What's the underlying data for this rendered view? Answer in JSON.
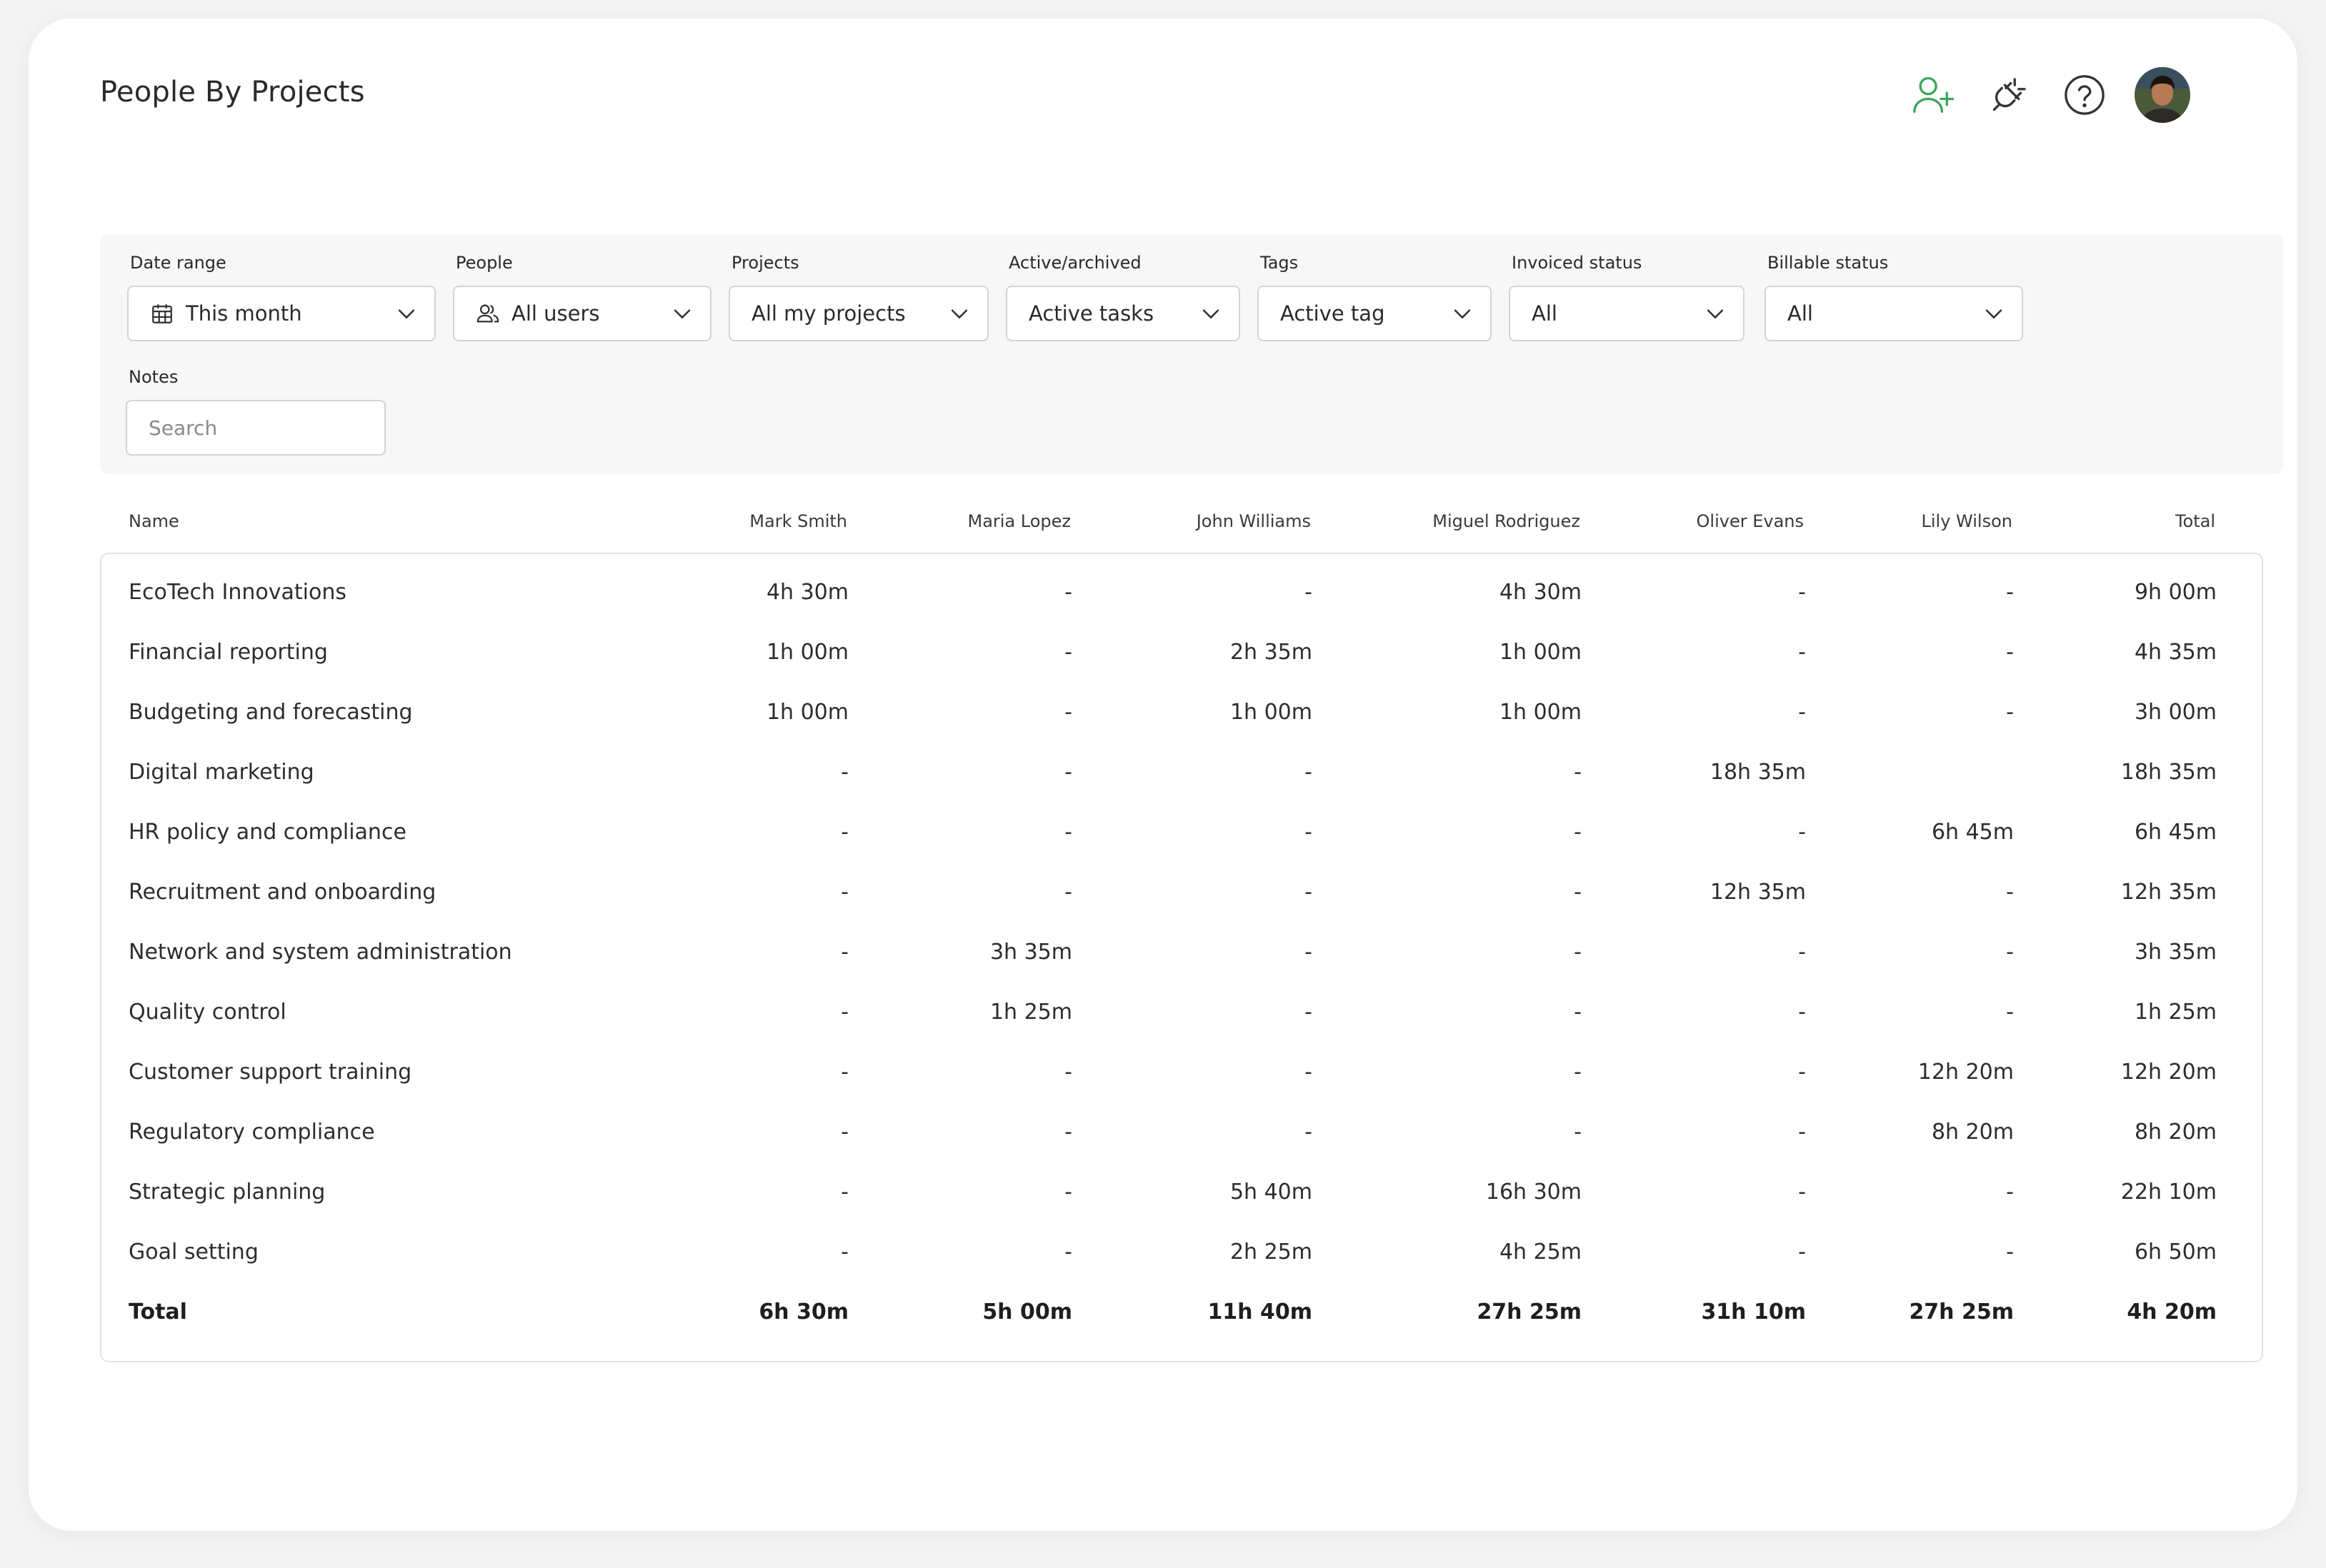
{
  "page": {
    "title": "People By Projects"
  },
  "header": {
    "icons": [
      "add-user-icon",
      "plug-icon",
      "help-icon",
      "avatar"
    ],
    "accent": "#3aa55a"
  },
  "filters": {
    "date_range": {
      "label": "Date range",
      "value": "This month"
    },
    "people": {
      "label": "People",
      "value": "All users"
    },
    "projects": {
      "label": "Projects",
      "value": "All my projects"
    },
    "active_archived": {
      "label": "Active/archived",
      "value": "Active tasks"
    },
    "tags": {
      "label": "Tags",
      "value": "Active tag"
    },
    "invoiced_status": {
      "label": "Invoiced status",
      "value": "All"
    },
    "billable_status": {
      "label": "Billable status",
      "value": "All"
    },
    "notes": {
      "label": "Notes",
      "placeholder": "Search"
    }
  },
  "table": {
    "columns": [
      "Name",
      "Mark Smith",
      "Maria Lopez",
      "John Williams",
      "Miguel Rodriguez",
      "Oliver Evans",
      "Lily Wilson",
      "Total"
    ],
    "rows": [
      [
        "EcoTech Innovations",
        "4h 30m",
        "-",
        "-",
        "4h 30m",
        "-",
        "-",
        "9h 00m"
      ],
      [
        "Financial reporting",
        "1h 00m",
        "-",
        "2h 35m",
        "1h 00m",
        "-",
        "-",
        "4h 35m"
      ],
      [
        "Budgeting and forecasting",
        "1h 00m",
        "-",
        "1h 00m",
        "1h 00m",
        "-",
        "-",
        "3h 00m"
      ],
      [
        "Digital marketing",
        "-",
        "-",
        "-",
        "-",
        "18h 35m",
        "",
        "18h 35m"
      ],
      [
        "HR policy and compliance",
        "-",
        "-",
        "-",
        "-",
        "-",
        "6h 45m",
        "6h 45m"
      ],
      [
        "Recruitment and onboarding",
        "-",
        "-",
        "-",
        "-",
        "12h 35m",
        "-",
        "12h 35m"
      ],
      [
        "Network and system administration",
        "-",
        "3h 35m",
        "-",
        "-",
        "-",
        "-",
        "3h 35m"
      ],
      [
        "Quality control",
        "-",
        "1h 25m",
        "-",
        "-",
        "-",
        "-",
        "1h 25m"
      ],
      [
        "Customer support training",
        "-",
        "-",
        "-",
        "-",
        "-",
        "12h 20m",
        "12h 20m"
      ],
      [
        "Regulatory compliance",
        "-",
        "-",
        "-",
        "-",
        "-",
        "8h 20m",
        "8h 20m"
      ],
      [
        "Strategic planning",
        "-",
        "-",
        "5h 40m",
        "16h 30m",
        "-",
        "-",
        "22h 10m"
      ],
      [
        "Goal setting",
        "-",
        "-",
        "2h 25m",
        "4h 25m",
        "-",
        "-",
        "6h 50m"
      ]
    ],
    "total": [
      "Total",
      "6h 30m",
      "5h 00m",
      "11h 40m",
      "27h 25m",
      "31h 10m",
      "27h 25m",
      "4h 20m"
    ]
  }
}
